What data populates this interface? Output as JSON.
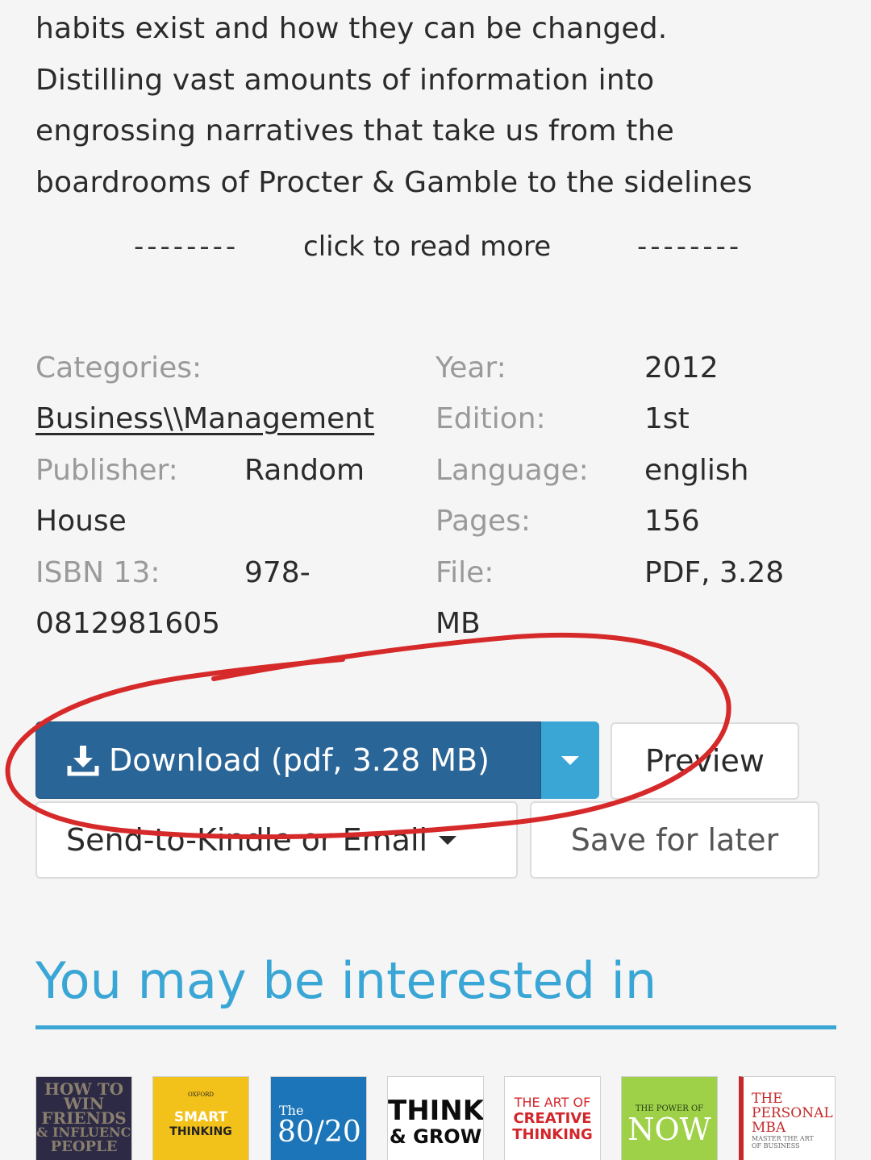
{
  "description": {
    "lines": [
      "habits exist and how they can be changed.",
      "Distilling vast amounts of information into",
      "engrossing narratives that take us from the",
      "boardrooms of Procter & Gamble to the sidelines"
    ]
  },
  "read_more": {
    "left_dashes": "--------",
    "label": "click to read more",
    "right_dashes": "--------"
  },
  "properties": {
    "categories_label": "Categories:",
    "categories_value": "Business\\\\Management",
    "publisher_label": "Publisher:",
    "publisher_value_1": "Random",
    "publisher_value_2": "House",
    "isbn_label": "ISBN 13:",
    "isbn_value_1": "978-",
    "isbn_value_2": "0812981605",
    "year_label": "Year:",
    "year_value": "2012",
    "edition_label": "Edition:",
    "edition_value": "1st",
    "language_label": "Language:",
    "language_value": "english",
    "pages_label": "Pages:",
    "pages_value": "156",
    "file_label": "File:",
    "file_value_1": "PDF, 3.28",
    "file_value_2": "MB"
  },
  "actions": {
    "download_label": "Download (pdf, 3.28 MB)",
    "preview_label": "Preview",
    "send_label": "Send-to-Kindle or Email",
    "save_label": "Save for later"
  },
  "related": {
    "title": "You may be interested in",
    "covers": [
      {
        "lines": [
          "HOW TO",
          "WIN",
          "FRIENDS",
          "& INFLUENCE",
          "PEOPLE"
        ]
      },
      {
        "lines": [
          "OXFORD",
          "SMART",
          "THINKING"
        ]
      },
      {
        "lines": [
          "The",
          "80/20"
        ]
      },
      {
        "lines": [
          "THINK",
          "& GROW"
        ]
      },
      {
        "lines": [
          "THE ART OF",
          "CREATIVE",
          "THINKING"
        ]
      },
      {
        "lines": [
          "THE POWER OF",
          "NOW"
        ]
      },
      {
        "lines": [
          "THE",
          "PERSONAL",
          "MBA",
          "MASTER THE ART",
          "OF BUSINESS"
        ]
      }
    ]
  },
  "colors": {
    "accent": "#3aa6d6",
    "download_button": "#2a6597",
    "annotation": "#d62a2a"
  }
}
